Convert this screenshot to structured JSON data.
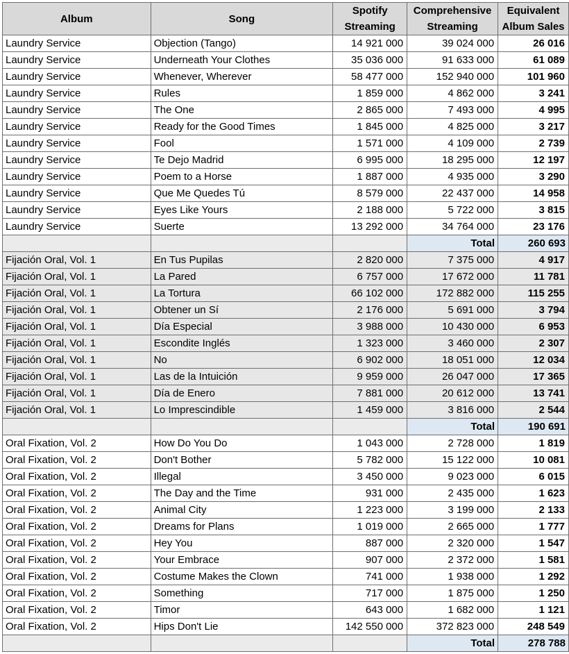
{
  "headers": {
    "album": "Album",
    "song": "Song",
    "spotify": "Spotify Streaming",
    "comprehensive": "Comprehensive Streaming",
    "equivalent": "Equivalent Album Sales"
  },
  "groups": [
    {
      "shaded": false,
      "rows": [
        {
          "album": "Laundry Service",
          "song": "Objection (Tango)",
          "spotify": "14 921 000",
          "comprehensive": "39 024 000",
          "eas": "26 016"
        },
        {
          "album": "Laundry Service",
          "song": "Underneath Your Clothes",
          "spotify": "35 036 000",
          "comprehensive": "91 633 000",
          "eas": "61 089"
        },
        {
          "album": "Laundry Service",
          "song": "Whenever, Wherever",
          "spotify": "58 477 000",
          "comprehensive": "152 940 000",
          "eas": "101 960"
        },
        {
          "album": "Laundry Service",
          "song": "Rules",
          "spotify": "1 859 000",
          "comprehensive": "4 862 000",
          "eas": "3 241"
        },
        {
          "album": "Laundry Service",
          "song": "The One",
          "spotify": "2 865 000",
          "comprehensive": "7 493 000",
          "eas": "4 995"
        },
        {
          "album": "Laundry Service",
          "song": "Ready for the Good Times",
          "spotify": "1 845 000",
          "comprehensive": "4 825 000",
          "eas": "3 217"
        },
        {
          "album": "Laundry Service",
          "song": "Fool",
          "spotify": "1 571 000",
          "comprehensive": "4 109 000",
          "eas": "2 739"
        },
        {
          "album": "Laundry Service",
          "song": "Te Dejo Madrid",
          "spotify": "6 995 000",
          "comprehensive": "18 295 000",
          "eas": "12 197"
        },
        {
          "album": "Laundry Service",
          "song": "Poem to a Horse",
          "spotify": "1 887 000",
          "comprehensive": "4 935 000",
          "eas": "3 290"
        },
        {
          "album": "Laundry Service",
          "song": "Que Me Quedes Tú",
          "spotify": "8 579 000",
          "comprehensive": "22 437 000",
          "eas": "14 958"
        },
        {
          "album": "Laundry Service",
          "song": "Eyes Like Yours",
          "spotify": "2 188 000",
          "comprehensive": "5 722 000",
          "eas": "3 815"
        },
        {
          "album": "Laundry Service",
          "song": "Suerte",
          "spotify": "13 292 000",
          "comprehensive": "34 764 000",
          "eas": "23 176"
        }
      ],
      "total_label": "Total",
      "total_value": "260 693"
    },
    {
      "shaded": true,
      "rows": [
        {
          "album": "Fijación Oral, Vol. 1",
          "song": "En Tus Pupilas",
          "spotify": "2 820 000",
          "comprehensive": "7 375 000",
          "eas": "4 917"
        },
        {
          "album": "Fijación Oral, Vol. 1",
          "song": "La Pared",
          "spotify": "6 757 000",
          "comprehensive": "17 672 000",
          "eas": "11 781"
        },
        {
          "album": "Fijación Oral, Vol. 1",
          "song": "La Tortura",
          "spotify": "66 102 000",
          "comprehensive": "172 882 000",
          "eas": "115 255"
        },
        {
          "album": "Fijación Oral, Vol. 1",
          "song": "Obtener un Sí",
          "spotify": "2 176 000",
          "comprehensive": "5 691 000",
          "eas": "3 794"
        },
        {
          "album": "Fijación Oral, Vol. 1",
          "song": "Día Especial",
          "spotify": "3 988 000",
          "comprehensive": "10 430 000",
          "eas": "6 953"
        },
        {
          "album": "Fijación Oral, Vol. 1",
          "song": "Escondite Inglés",
          "spotify": "1 323 000",
          "comprehensive": "3 460 000",
          "eas": "2 307"
        },
        {
          "album": "Fijación Oral, Vol. 1",
          "song": "No",
          "spotify": "6 902 000",
          "comprehensive": "18 051 000",
          "eas": "12 034"
        },
        {
          "album": "Fijación Oral, Vol. 1",
          "song": "Las de la Intuición",
          "spotify": "9 959 000",
          "comprehensive": "26 047 000",
          "eas": "17 365"
        },
        {
          "album": "Fijación Oral, Vol. 1",
          "song": "Día de Enero",
          "spotify": "7 881 000",
          "comprehensive": "20 612 000",
          "eas": "13 741"
        },
        {
          "album": "Fijación Oral, Vol. 1",
          "song": "Lo Imprescindible",
          "spotify": "1 459 000",
          "comprehensive": "3 816 000",
          "eas": "2 544"
        }
      ],
      "total_label": "Total",
      "total_value": "190 691"
    },
    {
      "shaded": false,
      "rows": [
        {
          "album": "Oral Fixation, Vol. 2",
          "song": "How Do You Do",
          "spotify": "1 043 000",
          "comprehensive": "2 728 000",
          "eas": "1 819"
        },
        {
          "album": "Oral Fixation, Vol. 2",
          "song": "Don't Bother",
          "spotify": "5 782 000",
          "comprehensive": "15 122 000",
          "eas": "10 081"
        },
        {
          "album": "Oral Fixation, Vol. 2",
          "song": "Illegal",
          "spotify": "3 450 000",
          "comprehensive": "9 023 000",
          "eas": "6 015"
        },
        {
          "album": "Oral Fixation, Vol. 2",
          "song": "The Day and the Time",
          "spotify": "931 000",
          "comprehensive": "2 435 000",
          "eas": "1 623"
        },
        {
          "album": "Oral Fixation, Vol. 2",
          "song": "Animal City",
          "spotify": "1 223 000",
          "comprehensive": "3 199 000",
          "eas": "2 133"
        },
        {
          "album": "Oral Fixation, Vol. 2",
          "song": "Dreams for Plans",
          "spotify": "1 019 000",
          "comprehensive": "2 665 000",
          "eas": "1 777"
        },
        {
          "album": "Oral Fixation, Vol. 2",
          "song": "Hey You",
          "spotify": "887 000",
          "comprehensive": "2 320 000",
          "eas": "1 547"
        },
        {
          "album": "Oral Fixation, Vol. 2",
          "song": "Your Embrace",
          "spotify": "907 000",
          "comprehensive": "2 372 000",
          "eas": "1 581"
        },
        {
          "album": "Oral Fixation, Vol. 2",
          "song": "Costume Makes the Clown",
          "spotify": "741 000",
          "comprehensive": "1 938 000",
          "eas": "1 292"
        },
        {
          "album": "Oral Fixation, Vol. 2",
          "song": "Something",
          "spotify": "717 000",
          "comprehensive": "1 875 000",
          "eas": "1 250"
        },
        {
          "album": "Oral Fixation, Vol. 2",
          "song": "Timor",
          "spotify": "643 000",
          "comprehensive": "1 682 000",
          "eas": "1 121"
        },
        {
          "album": "Oral Fixation, Vol. 2",
          "song": "Hips Don't Lie",
          "spotify": "142 550 000",
          "comprehensive": "372 823 000",
          "eas": "248 549"
        }
      ],
      "total_label": "Total",
      "total_value": "278 788"
    }
  ]
}
